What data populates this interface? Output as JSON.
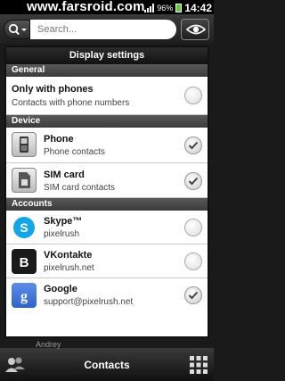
{
  "status": {
    "brand": "www.farsroid.com",
    "battery": "96%",
    "time": "14:42"
  },
  "search": {
    "placeholder": "Search..."
  },
  "dialog": {
    "title": "Display settings",
    "sections": [
      {
        "header": "General"
      },
      {
        "header": "Device"
      },
      {
        "header": "Accounts"
      }
    ],
    "general": {
      "title": "Only with phones",
      "subtitle": "Contacts with phone numbers",
      "checked": false
    },
    "device": [
      {
        "title": "Phone",
        "subtitle": "Phone contacts",
        "checked": true,
        "icon": "phone-icon"
      },
      {
        "title": "SIM card",
        "subtitle": "SIM card contacts",
        "checked": true,
        "icon": "sim-card-icon"
      }
    ],
    "accounts": [
      {
        "title": "Skype™",
        "subtitle": "pixelrush",
        "checked": false,
        "icon": "skype-icon"
      },
      {
        "title": "VKontakte",
        "subtitle": "pixelrush.net",
        "checked": false,
        "icon": "vkontakte-icon"
      },
      {
        "title": "Google",
        "subtitle": "support@pixelrush.net",
        "checked": true,
        "icon": "google-icon"
      }
    ]
  },
  "bottom": {
    "label": "Contacts",
    "behind_text": "Andrey"
  }
}
